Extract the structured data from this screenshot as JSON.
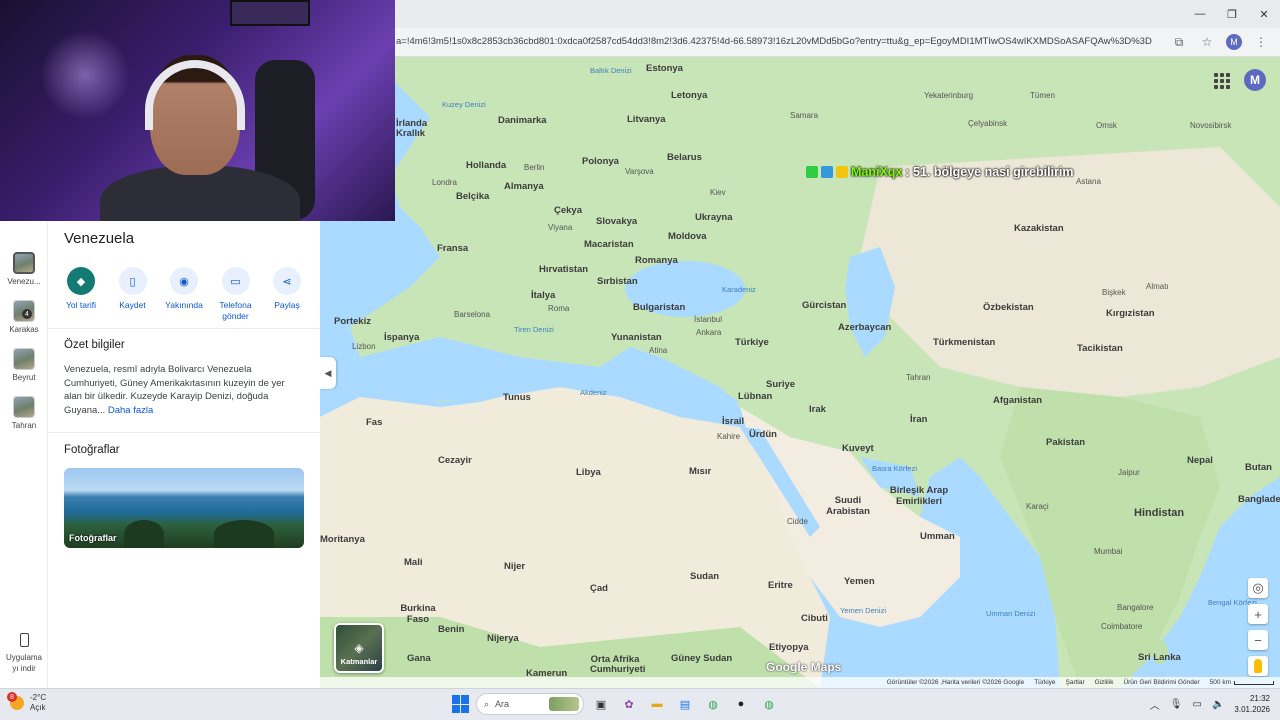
{
  "browser": {
    "url": "a=!4m6!3m5!1s0x8c2853cb36cbd801:0xdca0f2587cd54dd3!8m2!3d6.42375!4d-66.58973!16zL20vMDd5bGo?entry=ttu&g_ep=EgoyMDI1MTIwOS4wIKXMDSoASAFQAw%3D%3D",
    "profile_initial": "M",
    "minimize": "—",
    "maximize": "❐",
    "close": "✕"
  },
  "rail": {
    "items": [
      {
        "label": "Venezu..."
      },
      {
        "label": "Karakas",
        "badge": "4"
      },
      {
        "label": "Beyrut"
      },
      {
        "label": "Tahran"
      }
    ],
    "download_label_1": "Uygulama",
    "download_label_2": "yı indir"
  },
  "panel": {
    "title": "Venezuela",
    "actions": [
      {
        "label": "Yol tarifi",
        "icon": "directions-icon"
      },
      {
        "label": "Kaydet",
        "icon": "bookmark-icon"
      },
      {
        "label": "Yakınında",
        "icon": "nearby-icon"
      },
      {
        "label": "Telefona gönder",
        "icon": "send-to-phone-icon"
      },
      {
        "label": "Paylaş",
        "icon": "share-icon"
      }
    ],
    "summary_title": "Özet bilgiler",
    "summary_text": "Venezuela, resmî adıyla Bolivarcı Venezuela Cumhuriyeti, Güney Amerikakıtasının kuzeyin de yer alan bir ülkedir. Kuzeyde Karayip Denizi, doğuda Guyana...",
    "more_link": "Daha fazla",
    "photos_title": "Fotoğraflar",
    "photo_caption": "Fotoğraflar"
  },
  "map": {
    "avatar_initial": "M",
    "chat_user": "ManiXqx",
    "chat_message": ": 51. bölgeye nasi girebilirim",
    "layers_label": "Katmanlar",
    "logo": "Google Maps",
    "attribution": [
      "Görüntüler ©2026 ,Harita verileri ©2026 Google",
      "Türkiye",
      "Şartlar",
      "Gizlilik",
      "Ürün Geri Bildirimi Gönder"
    ],
    "scale": "500 km",
    "countries": [
      "Estonya",
      "Litvanya",
      "Danimarka",
      "Letonya",
      "Belarus",
      "Polonya",
      "Almanya",
      "Hollanda",
      "Belçika",
      "Çekya",
      "Slovakya",
      "Ukrayna",
      "Fransa",
      "Macaristan",
      "Moldova",
      "Hırvatistan",
      "Romanya",
      "Sırbistan",
      "İtalya",
      "Bulgaristan",
      "Portekiz",
      "İspanya",
      "Yunanistan",
      "Türkiye",
      "Gürcistan",
      "Azerbaycan",
      "Türkmenistan",
      "Özbekistan",
      "Kazakistan",
      "Kırgızistan",
      "Tacikistan",
      "Afganistan",
      "İran",
      "Irak",
      "Suriye",
      "Lübnan",
      "İsrail",
      "Ürdün",
      "Kuveyt",
      "Suudi Arabistan",
      "Birleşik Arap Emirlikleri",
      "Umman",
      "Yemen",
      "Pakistan",
      "Nepal",
      "Butan",
      "Hindistan",
      "Bangladeş",
      "Sri Lanka",
      "Tunus",
      "Fas",
      "Cezayir",
      "Libya",
      "Mısır",
      "Sudan",
      "Eritre",
      "Etiyopya",
      "Cibuti",
      "Çad",
      "Nijer",
      "Mali",
      "Moritanya",
      "Burkina Faso",
      "Benin",
      "Nijerya",
      "Gana",
      "Kamerun",
      "Orta Afrika Cumhuriyeti",
      "Güney Sudan",
      "İrlanda Krallık"
    ],
    "cities": [
      "Berlin",
      "Varşova",
      "Londra",
      "Kiev",
      "Viyana",
      "Roma",
      "Barselona",
      "Lizbon",
      "Atina",
      "İstanbul",
      "Ankara",
      "Kahire",
      "Cidde",
      "Tahran",
      "Bişkek",
      "Almatı",
      "Astana",
      "Omsk",
      "Novosibirsk",
      "Çelyabinsk",
      "Tümen",
      "Yekaterinburg",
      "Samara",
      "Mumbai",
      "Bangalore",
      "Coimbatore",
      "Jaipur",
      "Karaçi"
    ],
    "seas": [
      "Baltık Denizi",
      "Kuzey Denizi",
      "Karadeniz",
      "Tiren Denizi",
      "Akdeniz",
      "Basra Körfezi",
      "Yemen Denizi",
      "Umman Denizi",
      "Bengal Körfezi"
    ]
  },
  "taskbar": {
    "temperature": "-2°C",
    "weather_desc": "Açık",
    "weather_badge": "8",
    "search_placeholder": "Ara",
    "time": "21:32",
    "date": "3.01.2026"
  }
}
